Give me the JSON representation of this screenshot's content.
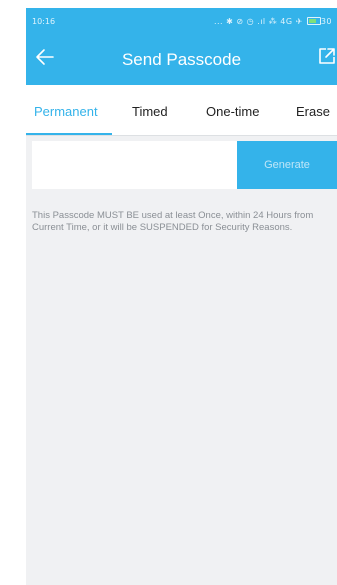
{
  "status_bar": {
    "time": "10:16",
    "icons_text": "... ✱ ⊘ ◷ .ıl ⁂ 4G ✈",
    "battery_level": "30"
  },
  "header": {
    "title": "Send Passcode",
    "back_icon": "arrow-left-icon",
    "share_icon": "share-external-icon"
  },
  "tabs": [
    {
      "label": "Permanent",
      "active": true
    },
    {
      "label": "Timed",
      "active": false
    },
    {
      "label": "One-time",
      "active": false
    },
    {
      "label": "Erase",
      "active": false
    }
  ],
  "form": {
    "passcode_value": "",
    "generate_label": "Generate"
  },
  "notice_text": "This Passcode MUST BE used at least Once, within 24 Hours from Current Time, or it will be SUSPENDED for Security Reasons.",
  "colors": {
    "accent": "#34b3ea",
    "background": "#f0f1f3",
    "notice_text": "#8a8f95"
  }
}
